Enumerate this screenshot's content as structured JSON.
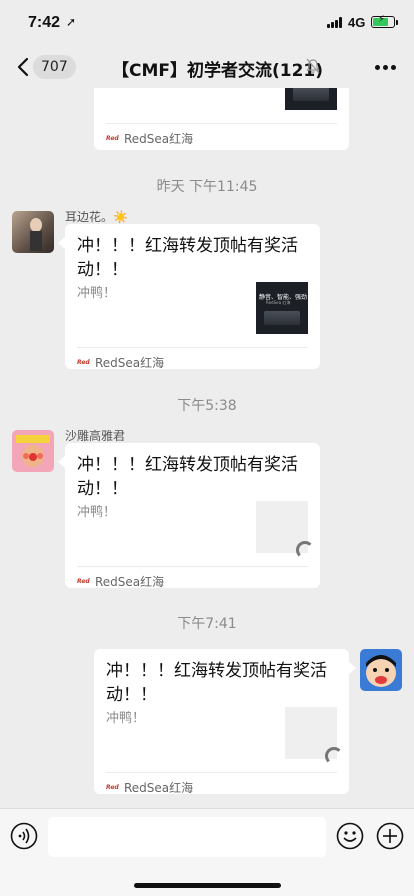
{
  "status_bar": {
    "time": "7:42",
    "network": "4G"
  },
  "nav": {
    "back_count": "707",
    "title": "【CMF】初学者交流(121)"
  },
  "messages": [
    {
      "kind": "link_card",
      "side": "left",
      "source": "RedSea红海"
    },
    {
      "kind": "timestamp",
      "text": "昨天 下午11:45"
    },
    {
      "kind": "link_card",
      "side": "left",
      "sender": "耳边花。☀️",
      "title": "冲！！！红海转发顶帖有奖活动！！",
      "desc": "冲鸭！",
      "thumb": {
        "style": "dark",
        "text1": "静音、智能、强劲",
        "text2": "RedSea 红海"
      },
      "source": "RedSea红海"
    },
    {
      "kind": "timestamp",
      "text": "下午5:38"
    },
    {
      "kind": "link_card",
      "side": "left",
      "sender": "沙雕高雅君",
      "title": "冲！！！红海转发顶帖有奖活动！！",
      "desc": "冲鸭！",
      "thumb": {
        "style": "loading"
      },
      "source": "RedSea红海"
    },
    {
      "kind": "timestamp",
      "text": "下午7:41"
    },
    {
      "kind": "link_card",
      "side": "right",
      "title": "冲！！！红海转发顶帖有奖活动！！",
      "desc": "冲鸭！",
      "thumb": {
        "style": "loading"
      },
      "source": "RedSea红海"
    }
  ],
  "brand_icon_text": "RedSea",
  "colors": {
    "bg": "#ededed",
    "card": "#ffffff",
    "battery": "#34c759",
    "muted": "#8b8b8b"
  },
  "icons": [
    "back-chevron-icon",
    "mute-bell-icon",
    "more-icon",
    "voice-icon",
    "emoji-icon",
    "plus-icon"
  ]
}
